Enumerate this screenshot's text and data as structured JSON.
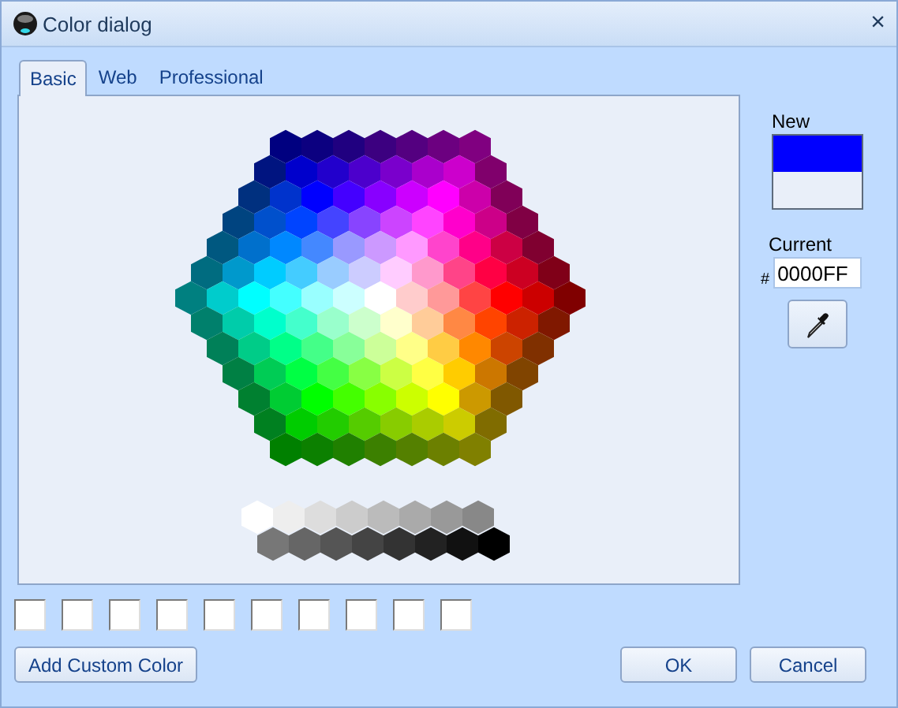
{
  "window": {
    "title": "Color dialog",
    "close": "×"
  },
  "tabs": [
    {
      "label": "Basic",
      "selected": true
    },
    {
      "label": "Web",
      "selected": false
    },
    {
      "label": "Professional",
      "selected": false
    }
  ],
  "swatches": [
    [
      {
        "color": "#000080"
      },
      {
        "color": "#0c0080"
      },
      {
        "color": "#200080"
      },
      {
        "color": "#3c0080"
      },
      {
        "color": "#540080"
      },
      {
        "color": "#6c0080"
      },
      {
        "color": "#800080"
      }
    ],
    [
      {
        "color": "#001480"
      },
      {
        "color": "#0000cc"
      },
      {
        "color": "#2200cc"
      },
      {
        "color": "#4c00cc"
      },
      {
        "color": "#7a00cc"
      },
      {
        "color": "#aa00cc"
      },
      {
        "color": "#cc00cc"
      },
      {
        "color": "#80006c"
      }
    ],
    [
      {
        "color": "#00307f"
      },
      {
        "color": "#0033cc"
      },
      {
        "color": "#0000ff"
      },
      {
        "color": "#4400ff"
      },
      {
        "color": "#8800ff"
      },
      {
        "color": "#cc00ff"
      },
      {
        "color": "#ff00ff"
      },
      {
        "color": "#cc00aa"
      },
      {
        "color": "#800058"
      }
    ],
    [
      {
        "color": "#004480"
      },
      {
        "color": "#0050cc"
      },
      {
        "color": "#0044ff"
      },
      {
        "color": "#4444ff"
      },
      {
        "color": "#8844ff"
      },
      {
        "color": "#cc44ff"
      },
      {
        "color": "#ff44ff"
      },
      {
        "color": "#ff00cc"
      },
      {
        "color": "#cc0088"
      },
      {
        "color": "#800044"
      }
    ],
    [
      {
        "color": "#005880"
      },
      {
        "color": "#0070cc"
      },
      {
        "color": "#0088ff"
      },
      {
        "color": "#4488ff"
      },
      {
        "color": "#9999ff"
      },
      {
        "color": "#cc99ff"
      },
      {
        "color": "#ff99ff"
      },
      {
        "color": "#ff44cc"
      },
      {
        "color": "#ff0088"
      },
      {
        "color": "#cc0044"
      },
      {
        "color": "#800030"
      }
    ],
    [
      {
        "color": "#006c80"
      },
      {
        "color": "#0099cc"
      },
      {
        "color": "#00ccff"
      },
      {
        "color": "#44ccff"
      },
      {
        "color": "#99ccff"
      },
      {
        "color": "#ccccff"
      },
      {
        "color": "#ffccff"
      },
      {
        "color": "#ff99cc"
      },
      {
        "color": "#ff4488"
      },
      {
        "color": "#ff0044"
      },
      {
        "color": "#cc0022"
      },
      {
        "color": "#800018"
      }
    ],
    [
      {
        "color": "#008080"
      },
      {
        "color": "#00cccc"
      },
      {
        "color": "#00ffff"
      },
      {
        "color": "#44ffff"
      },
      {
        "color": "#99ffff"
      },
      {
        "color": "#ccffff"
      },
      {
        "color": "#ffffff"
      },
      {
        "color": "#ffcccc"
      },
      {
        "color": "#ff9999"
      },
      {
        "color": "#ff4444"
      },
      {
        "color": "#ff0000"
      },
      {
        "color": "#cc0000"
      },
      {
        "color": "#800000"
      }
    ],
    [
      {
        "color": "#00806c"
      },
      {
        "color": "#00ccaa"
      },
      {
        "color": "#00ffcc"
      },
      {
        "color": "#44ffcc"
      },
      {
        "color": "#99ffcc"
      },
      {
        "color": "#ccffcc"
      },
      {
        "color": "#ffffcc"
      },
      {
        "color": "#ffcc99"
      },
      {
        "color": "#ff8844"
      },
      {
        "color": "#ff4400"
      },
      {
        "color": "#cc2200"
      },
      {
        "color": "#801800"
      }
    ],
    [
      {
        "color": "#008058"
      },
      {
        "color": "#00cc88"
      },
      {
        "color": "#00ff88"
      },
      {
        "color": "#44ff88"
      },
      {
        "color": "#88ff99"
      },
      {
        "color": "#ccff99"
      },
      {
        "color": "#ffff88"
      },
      {
        "color": "#ffcc44"
      },
      {
        "color": "#ff8800"
      },
      {
        "color": "#cc4400"
      },
      {
        "color": "#803000"
      }
    ],
    [
      {
        "color": "#008044"
      },
      {
        "color": "#00cc55"
      },
      {
        "color": "#00ff44"
      },
      {
        "color": "#44ff44"
      },
      {
        "color": "#88ff44"
      },
      {
        "color": "#ccff44"
      },
      {
        "color": "#ffff44"
      },
      {
        "color": "#ffcc00"
      },
      {
        "color": "#cc7700"
      },
      {
        "color": "#804400"
      }
    ],
    [
      {
        "color": "#008030"
      },
      {
        "color": "#00cc33"
      },
      {
        "color": "#00ff00"
      },
      {
        "color": "#44ff00"
      },
      {
        "color": "#88ff00"
      },
      {
        "color": "#ccff00"
      },
      {
        "color": "#ffff00"
      },
      {
        "color": "#cc9900"
      },
      {
        "color": "#805800"
      }
    ],
    [
      {
        "color": "#008020"
      },
      {
        "color": "#00cc00"
      },
      {
        "color": "#22cc00"
      },
      {
        "color": "#55cc00"
      },
      {
        "color": "#88cc00"
      },
      {
        "color": "#aacc00"
      },
      {
        "color": "#cccc00"
      },
      {
        "color": "#806c00"
      }
    ],
    [
      {
        "color": "#008000"
      },
      {
        "color": "#0c8000"
      },
      {
        "color": "#208000"
      },
      {
        "color": "#3c8000"
      },
      {
        "color": "#548000"
      },
      {
        "color": "#6c8000"
      },
      {
        "color": "#808000"
      }
    ]
  ],
  "grays": [
    [
      {
        "color": "#ffffff"
      },
      {
        "color": "#eeeeee"
      },
      {
        "color": "#dddddd"
      },
      {
        "color": "#cccccc"
      },
      {
        "color": "#bbbbbb"
      },
      {
        "color": "#aaaaaa"
      },
      {
        "color": "#999999"
      },
      {
        "color": "#888888"
      }
    ],
    [
      {
        "color": "#777777"
      },
      {
        "color": "#666666"
      },
      {
        "color": "#555555"
      },
      {
        "color": "#444444"
      },
      {
        "color": "#333333"
      },
      {
        "color": "#222222"
      },
      {
        "color": "#111111"
      },
      {
        "color": "#000000"
      }
    ]
  ],
  "new_label": "New",
  "preview": [
    {
      "color": "#0000ff"
    },
    {
      "color": "#e9eff9"
    }
  ],
  "current_label": "Current",
  "hash": "#",
  "hex_value": "0000FF",
  "custom_colors": [
    {
      "empty": true
    },
    {
      "empty": true
    },
    {
      "empty": true
    },
    {
      "empty": true
    },
    {
      "empty": true
    },
    {
      "empty": true
    },
    {
      "empty": true
    },
    {
      "empty": true
    },
    {
      "empty": true
    },
    {
      "empty": true
    }
  ],
  "buttons": {
    "add": "Add Custom Color",
    "ok": "OK",
    "cancel": "Cancel"
  }
}
